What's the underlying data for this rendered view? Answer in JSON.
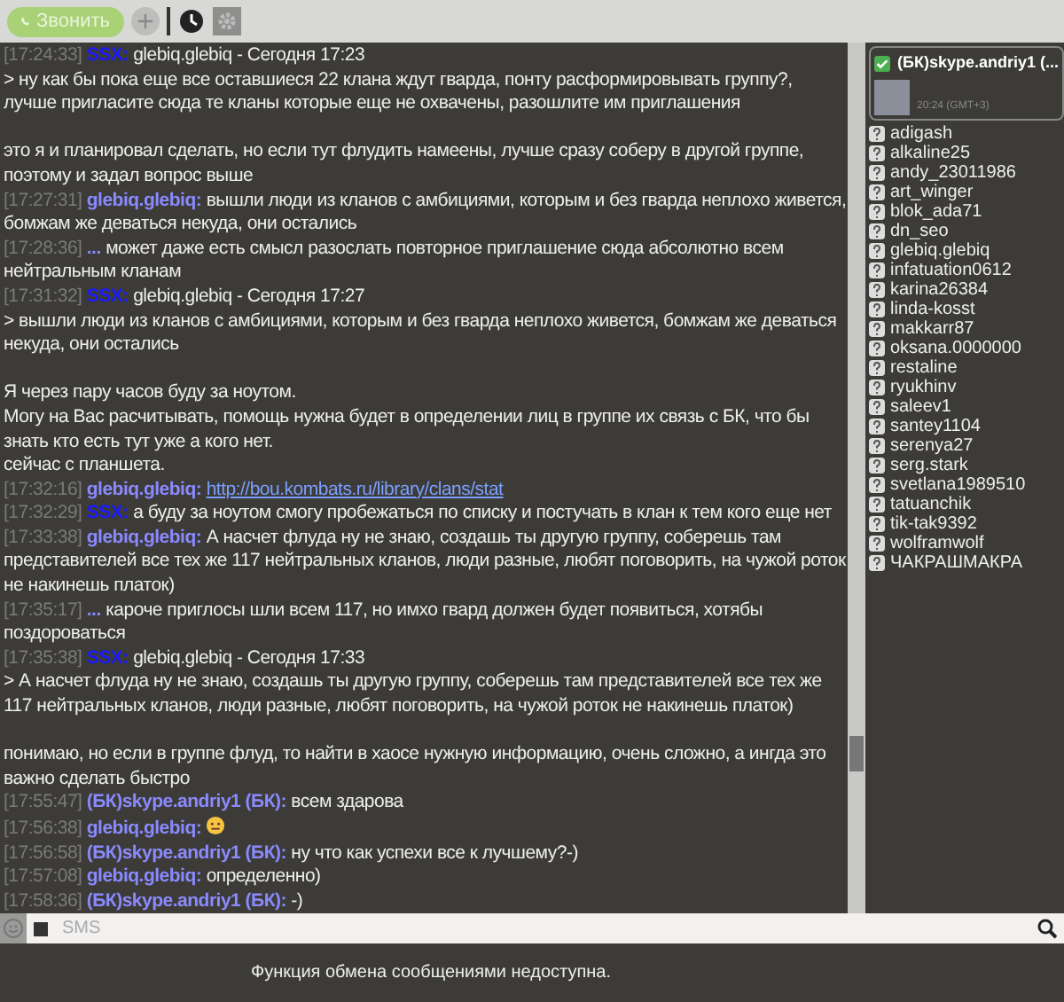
{
  "toolbar": {
    "call_button": "Звонить"
  },
  "messages": [
    {
      "time": "[17:24:33]",
      "author": "SSX:",
      "color": "#1a1aff",
      "kind": "text",
      "text": "glebiq.glebiq - Сегодня 17:23\n> ну как бы пока еще все оставшиеся 22 клана ждут гварда, понту расформировывать группу?, лучше пригласите сюда те кланы которые еще не охвачены, разошлите им приглашения\n\nэто я и планировал сделать, но если тут флудить намеены, лучше сразу соберу в другой группе, поэтому и задал вопрос выше"
    },
    {
      "time": "[17:27:31]",
      "author": "glebiq.glebiq:",
      "color": "#8a8aff",
      "kind": "text",
      "text": "вышли люди из кланов с амбициями, которым и без гварда неплохо живется, бомжам же деваться некуда, они остались"
    },
    {
      "time": "[17:28:36]",
      "author": "...",
      "color": "#8a8aff",
      "kind": "text",
      "text": "может даже есть смысл разослать повторное приглашение сюда абсолютно всем нейтральным кланам"
    },
    {
      "time": "[17:31:32]",
      "author": "SSX:",
      "color": "#1a1aff",
      "kind": "text",
      "text": "glebiq.glebiq - Сегодня 17:27\n> вышли люди из кланов с амбициями, которым и без гварда неплохо живется, бомжам же деваться некуда, они остались\n\nЯ через пару часов буду за ноутом.\nМогу на Вас расчитывать, помощь нужна будет в определении лиц в группе их связь с БК, что бы знать кто есть тут уже а кого нет.\nсейчас с планшета."
    },
    {
      "time": "[17:32:16]",
      "author": "glebiq.glebiq:",
      "color": "#8a8aff",
      "kind": "link",
      "text": "http://bou.kombats.ru/library/clans/stat"
    },
    {
      "time": "[17:32:29]",
      "author": "SSX:",
      "color": "#1a1aff",
      "kind": "text",
      "text": "а буду за ноутом смогу пробежаться по списку и постучать в клан к тем кого еще нет"
    },
    {
      "time": "[17:33:38]",
      "author": "glebiq.glebiq:",
      "color": "#8a8aff",
      "kind": "text",
      "text": "А насчет флуда ну не знаю, создашь ты другую группу, соберешь там представителей все тех же 117 нейтральных кланов, люди разные, любят поговорить, на чужой роток не накинешь платок)"
    },
    {
      "time": "[17:35:17]",
      "author": "...",
      "color": "#8a8aff",
      "kind": "text",
      "text": "кароче приглосы шли всем 117, но имхо гвард должен будет появиться, хотябы поздороваться"
    },
    {
      "time": "[17:35:38]",
      "author": "SSX:",
      "color": "#1a1aff",
      "kind": "text",
      "text": "glebiq.glebiq - Сегодня 17:33\n> А насчет флуда ну не знаю, создашь ты другую группу, соберешь там представителей все тех же 117 нейтральных кланов, люди разные, любят поговорить, на чужой роток не накинешь платок)\n\nпонимаю, но если в группе флуд, то найти в хаосе нужную информацию, очень сложно, а ингда это важно сделать быстро"
    },
    {
      "time": "[17:55:47]",
      "author": "(БК)skype.andriy1 (БК):",
      "color": "#8a8aff",
      "kind": "text",
      "text": "всем здарова"
    },
    {
      "time": "[17:56:38]",
      "author": "glebiq.glebiq:",
      "color": "#8a8aff",
      "kind": "emoji"
    },
    {
      "time": "[17:56:58]",
      "author": "(БК)skype.andriy1 (БК):",
      "color": "#8a8aff",
      "kind": "text",
      "text": "ну что как успехи все к лучшему?-)"
    },
    {
      "time": "[17:57:08]",
      "author": "glebiq.glebiq:",
      "color": "#8a8aff",
      "kind": "text",
      "text": "определенно)"
    },
    {
      "time": "[17:58:36]",
      "author": "(БК)skype.andriy1 (БК):",
      "color": "#8a8aff",
      "kind": "text",
      "text": "-)"
    }
  ],
  "profile": {
    "name": "(БК)skype.andriy1 (...",
    "local_time": "20:24 (GMT+3)"
  },
  "contacts": [
    "adigash",
    "alkaline25",
    "andy_23011986",
    "art_winger",
    "blok_ada71",
    "dn_seo",
    "glebiq.glebiq",
    "infatuation0612",
    "karina26384",
    "linda-kosst",
    "makkarr87",
    "oksana.0000000",
    "restaline",
    "ryukhinv",
    "saleev1",
    "santey1104",
    "serenya27",
    "serg.stark",
    "svetlana1989510",
    "tatuanchik",
    "tik-tak9392",
    "wolframwolf",
    "ЧАКРАШМАКРА"
  ],
  "input": {
    "placeholder": "SMS"
  },
  "notice": "Функция обмена сообщениями недоступна."
}
